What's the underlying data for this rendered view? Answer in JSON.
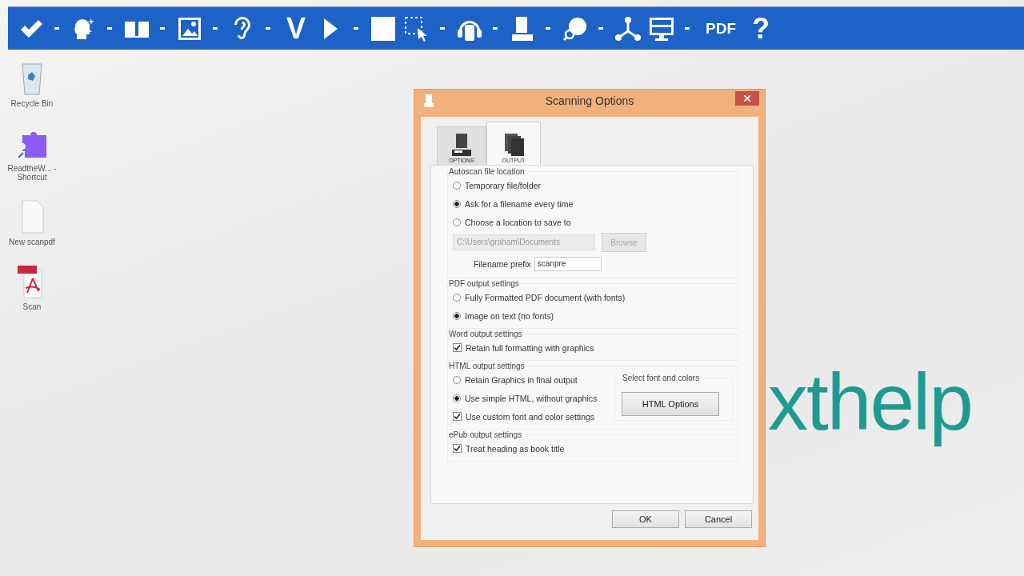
{
  "toolbar": {
    "items": [
      {
        "kind": "check",
        "dropdown": true
      },
      {
        "kind": "speaker",
        "dropdown": true
      },
      {
        "kind": "book",
        "dropdown": true
      },
      {
        "kind": "image",
        "dropdown": true
      },
      {
        "kind": "ear",
        "dropdown": true
      },
      {
        "kind": "text",
        "label": "V",
        "dropdown": false
      },
      {
        "kind": "play",
        "dropdown": true
      },
      {
        "kind": "stop",
        "dropdown": false
      },
      {
        "kind": "select",
        "dropdown": true
      },
      {
        "kind": "headphones",
        "dropdown": true
      },
      {
        "kind": "scanner",
        "dropdown": true
      },
      {
        "kind": "globe",
        "dropdown": true
      },
      {
        "kind": "nodes",
        "dropdown": false
      },
      {
        "kind": "monitor",
        "dropdown": true
      },
      {
        "kind": "text",
        "label": "PDF",
        "dropdown": false
      },
      {
        "kind": "text",
        "label": "?",
        "dropdown": false
      }
    ]
  },
  "desktop_icons": [
    {
      "kind": "recycle-bin",
      "label": "Recycle Bin"
    },
    {
      "kind": "puzzle",
      "label": "ReadtheW... - Shortcut"
    },
    {
      "kind": "document",
      "label": "New scanpdf"
    },
    {
      "kind": "pdf",
      "label": "Scan"
    }
  ],
  "wallpaper_text": "xthelp",
  "dialog": {
    "title": "Scanning Options",
    "tabs": [
      {
        "label": "OPTIONS",
        "kind": "scanner",
        "selected": false
      },
      {
        "label": "OUTPUT",
        "kind": "pages",
        "selected": true
      }
    ],
    "groups": [
      {
        "title": "Autoscan file location",
        "controls": [
          {
            "kind": "radio",
            "label": "Temporary file/folder",
            "checked": false
          },
          {
            "kind": "radio",
            "label": "Ask for a filename every time",
            "checked": true
          },
          {
            "kind": "radio",
            "label": "Choose a location to save to",
            "checked": false
          },
          {
            "kind": "path",
            "value": "C:\\Users\\graham\\Documents",
            "button": "Browse",
            "disabled": true
          },
          {
            "kind": "prefix",
            "label": "Filename prefix",
            "value": "scanpre"
          }
        ]
      },
      {
        "title": "PDF output settings",
        "controls": [
          {
            "kind": "radio",
            "label": "Fully Formatted PDF document (with fonts)",
            "checked": false
          },
          {
            "kind": "radio",
            "label": "Image on text (no fonts)",
            "checked": true
          }
        ]
      },
      {
        "title": "Word output settings",
        "controls": [
          {
            "kind": "checkbox",
            "label": "Retain full formatting with graphics",
            "checked": true
          }
        ]
      },
      {
        "title": "HTML output settings",
        "controls": [
          {
            "kind": "radio",
            "label": "Retain Graphics in final output",
            "checked": false
          },
          {
            "kind": "radio",
            "label": "Use simple HTML, without graphics",
            "checked": true
          },
          {
            "kind": "checkbox",
            "label": "Use custom font and color settings",
            "checked": true
          }
        ],
        "side": {
          "title": "Select font and colors",
          "button": "HTML Options"
        }
      },
      {
        "title": "ePub output settings",
        "controls": [
          {
            "kind": "checkbox",
            "label": "Treat heading as book title",
            "checked": true
          }
        ]
      }
    ],
    "buttons": [
      "OK",
      "Cancel"
    ]
  }
}
